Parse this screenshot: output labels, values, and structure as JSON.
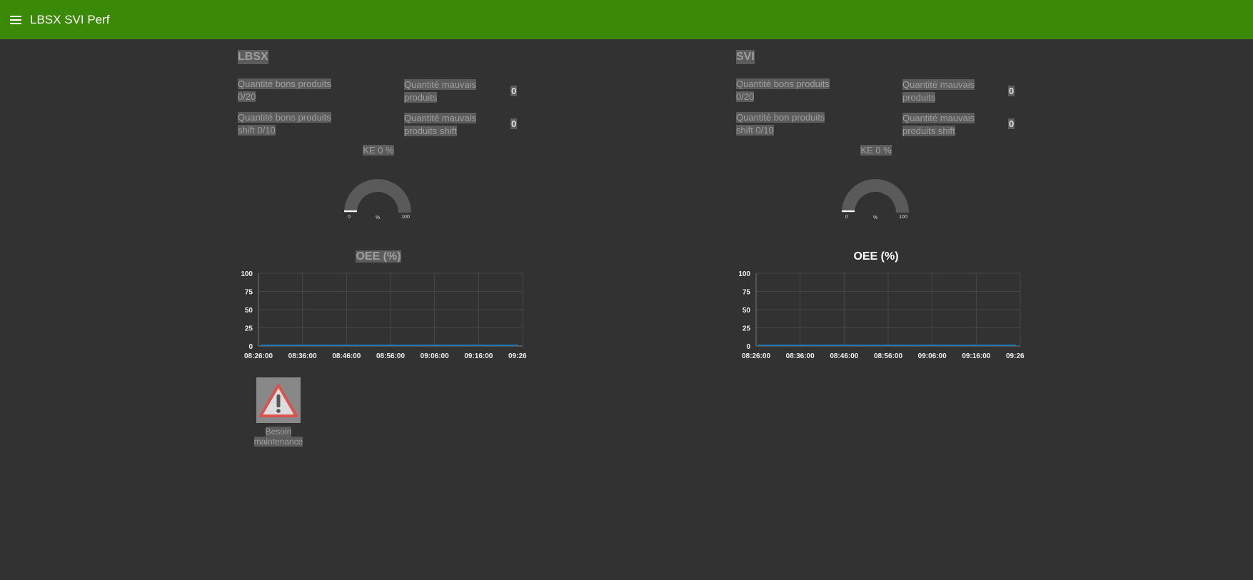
{
  "app": {
    "title": "LBSX SVI Perf"
  },
  "panels": [
    {
      "title": "LBSX",
      "good_qty_label": "Quantité bons produits 0/20",
      "bad_qty_label": "Quantité mauvais produits",
      "bad_qty_value": "0",
      "good_shift_label": "Quantité bons produits shift 0/10",
      "bad_shift_label": "Quantité mauvais produits shift",
      "bad_shift_value": "0",
      "ke_label": "KE 0 %",
      "gauge": {
        "value": 0,
        "min_label": "0",
        "unit": "%",
        "max_label": "100"
      },
      "chart_title": "OEE (%)",
      "chart_data": {
        "type": "line",
        "title": "OEE (%)",
        "x": [
          "08:26:00",
          "08:36:00",
          "08:46:00",
          "08:56:00",
          "09:06:00",
          "09:16:00",
          "09:26:00"
        ],
        "y_ticks": [
          0,
          25,
          50,
          75,
          100
        ],
        "ylim": [
          0,
          100
        ],
        "series": [
          {
            "values": [
              0,
              0,
              0,
              0,
              0,
              0,
              0
            ],
            "color": "#1f77b4"
          }
        ],
        "grid": true
      },
      "maintenance_label": "Besoin maintenance"
    },
    {
      "title": "SVI",
      "good_qty_label": "Quantité bons produits 0/20",
      "bad_qty_label": "Quantité mauvais produits",
      "bad_qty_value": "0",
      "good_shift_label": "Quantité bon produits shift 0/10",
      "bad_shift_label": "Quantité mauvais produits shift",
      "bad_shift_value": "0",
      "ke_label": "KE 0 %",
      "gauge": {
        "value": 0,
        "min_label": "0",
        "unit": "%",
        "max_label": "100"
      },
      "chart_title": "OEE (%)",
      "chart_data": {
        "type": "line",
        "title": "OEE (%)",
        "x": [
          "08:26:00",
          "08:36:00",
          "08:46:00",
          "08:56:00",
          "09:06:00",
          "09:16:00",
          "09:26:00"
        ],
        "y_ticks": [
          0,
          25,
          50,
          75,
          100
        ],
        "ylim": [
          0,
          100
        ],
        "series": [
          {
            "values": [
              0,
              0,
              0,
              0,
              0,
              0,
              0
            ],
            "color": "#1f77b4"
          }
        ],
        "grid": true
      }
    }
  ],
  "colors": {
    "topbar": "#3b8a07",
    "background": "#323232",
    "highlight": "#5c5c5c",
    "warning": "#d9534f"
  }
}
